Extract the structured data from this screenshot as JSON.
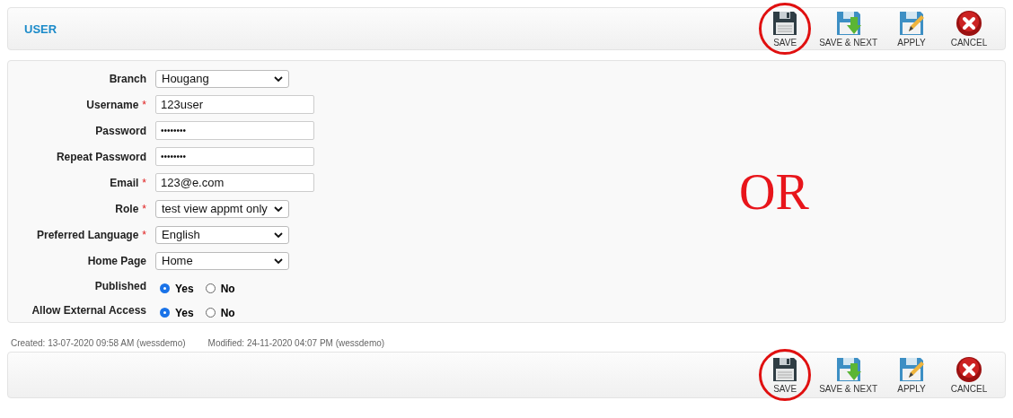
{
  "header": {
    "title": "USER"
  },
  "toolbar_top": [
    {
      "kind": "save",
      "label": "SAVE",
      "highlighted": true
    },
    {
      "kind": "save_next",
      "label": "SAVE & NEXT",
      "highlighted": false
    },
    {
      "kind": "apply",
      "label": "APPLY",
      "highlighted": false
    },
    {
      "kind": "cancel",
      "label": "CANCEL",
      "highlighted": false
    }
  ],
  "form": [
    {
      "kind": "select",
      "label": "Branch",
      "value": "Hougang"
    },
    {
      "kind": "text",
      "label": "Username",
      "required_mark": "*",
      "value": "123user"
    },
    {
      "kind": "password",
      "label": "Password",
      "value": "••••••••"
    },
    {
      "kind": "password",
      "label": "Repeat Password",
      "value": "••••••••"
    },
    {
      "kind": "text",
      "label": "Email",
      "required_mark": "*",
      "value": "123@e.com"
    },
    {
      "kind": "select",
      "label": "Role",
      "required_mark": "*",
      "value": "test view appmt only"
    },
    {
      "kind": "select",
      "label": "Preferred Language",
      "required_mark": "*",
      "value": "English"
    },
    {
      "kind": "select",
      "label": "Home Page",
      "value": "Home"
    },
    {
      "kind": "radio",
      "label": "Published",
      "options": [
        {
          "label": "Yes",
          "selected": true
        },
        {
          "label": "No",
          "selected": false
        }
      ]
    },
    {
      "kind": "radio",
      "label": "Allow External Access",
      "options": [
        {
          "label": "Yes",
          "selected": true
        },
        {
          "label": "No",
          "selected": false
        }
      ]
    }
  ],
  "note": "OR",
  "footer": {
    "created": "Created: 13-07-2020 09:58 AM (wessdemo)",
    "modified": "Modified: 24-11-2020 04:07 PM (wessdemo)"
  },
  "toolbar_bottom": [
    {
      "kind": "save",
      "label": "SAVE",
      "highlighted": true
    },
    {
      "kind": "save_next",
      "label": "SAVE & NEXT",
      "highlighted": false
    },
    {
      "kind": "apply",
      "label": "APPLY",
      "highlighted": false
    },
    {
      "kind": "cancel",
      "label": "CANCEL",
      "highlighted": false
    }
  ]
}
